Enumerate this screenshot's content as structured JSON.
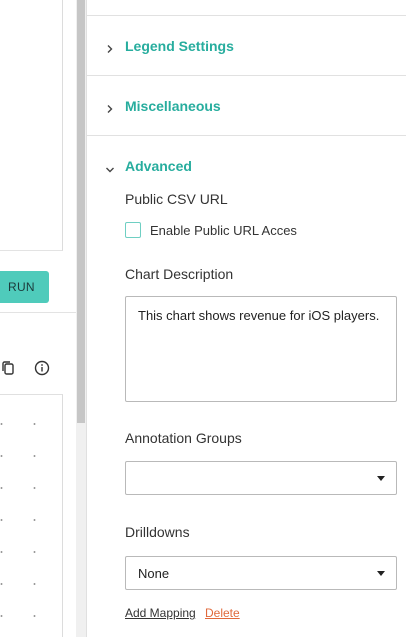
{
  "left_panel": {
    "run_label": "RUN"
  },
  "sections": {
    "legend_settings": "Legend Settings",
    "miscellaneous": "Miscellaneous",
    "advanced": "Advanced"
  },
  "advanced": {
    "public_csv_label": "Public CSV URL",
    "enable_public_url_label": "Enable Public URL Acces",
    "enable_public_url_checked": false,
    "chart_description_label": "Chart Description",
    "chart_description_value": "This chart shows revenue for iOS players.",
    "annotation_groups_label": "Annotation Groups",
    "annotation_groups_value": "",
    "drilldowns_label": "Drilldowns",
    "drilldowns_value": "None",
    "add_mapping_label": "Add Mapping",
    "delete_label": "Delete"
  },
  "colors": {
    "accent": "#27ad9e",
    "run_button": "#4fcbbb",
    "delete_link": "#e0693b"
  },
  "icons": {
    "copy": "copy-icon",
    "info": "info-icon",
    "chevron_right": "chevron-right-icon",
    "chevron_down": "chevron-down-icon"
  }
}
